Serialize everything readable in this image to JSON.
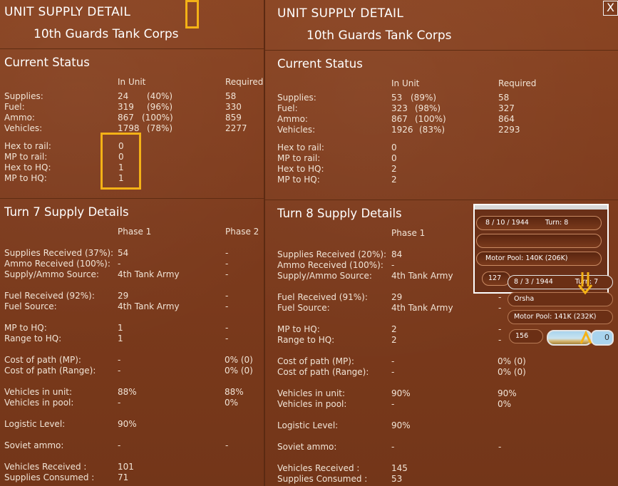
{
  "colors": {
    "panel": "#7d3b1d",
    "highlight": "#f4b216",
    "text": "#f3e6d8"
  },
  "left": {
    "title": "UNIT SUPPLY DETAIL",
    "unit": "10th Guards Tank Corps",
    "current_status": "Current Status",
    "col_in_unit": "In Unit",
    "col_required": "Required",
    "rows": [
      {
        "label": "Supplies:",
        "in": "24",
        "pct": "(40%)",
        "req": "58"
      },
      {
        "label": "Fuel:",
        "in": "319",
        "pct": "(96%)",
        "req": "330"
      },
      {
        "label": "Ammo:",
        "in": "867",
        "pct": "(100%)",
        "req": "859"
      },
      {
        "label": "Vehicles:",
        "in": "1798",
        "pct": "(78%)",
        "req": "2277"
      }
    ],
    "dist": [
      {
        "label": "Hex to rail:",
        "val": "0"
      },
      {
        "label": "MP to rail:",
        "val": "0"
      },
      {
        "label": "Hex to HQ:",
        "val": "1"
      },
      {
        "label": "MP to HQ:",
        "val": "1"
      }
    ],
    "turn_title": "Turn 7 Supply Details",
    "phase1": "Phase 1",
    "phase2": "Phase 2",
    "details": [
      {
        "label": "Supplies Received (37%):",
        "p1": "54",
        "p2": "-"
      },
      {
        "label": "Ammo Received (100%):",
        "p1": "-",
        "p2": "-"
      },
      {
        "label": "Supply/Ammo Source:",
        "p1": "4th Tank Army",
        "p2": "-"
      },
      {
        "label": "Fuel Received (92%):",
        "p1": "29",
        "p2": "-"
      },
      {
        "label": "Fuel Source:",
        "p1": "4th Tank Army",
        "p2": "-"
      },
      {
        "label": "MP to HQ:",
        "p1": "1",
        "p2": "-"
      },
      {
        "label": "Range to HQ:",
        "p1": "1",
        "p2": "-"
      },
      {
        "label": "Cost of path (MP):",
        "p1": "-",
        "p2": "0% (0)"
      },
      {
        "label": "Cost of path (Range):",
        "p1": "-",
        "p2": "0% (0)"
      },
      {
        "label": "Vehicles in unit:",
        "p1": "88%",
        "p2": "88%"
      },
      {
        "label": "Vehicles in pool:",
        "p1": "-",
        "p2": "0%"
      },
      {
        "label": "Logistic Level:",
        "p1": "90%",
        "p2": ""
      },
      {
        "label": "Soviet ammo:",
        "p1": "-",
        "p2": "-"
      },
      {
        "label": "Vehicles Received :",
        "p1": "101",
        "p2": ""
      },
      {
        "label": "Supplies Consumed :",
        "p1": "71",
        "p2": ""
      }
    ]
  },
  "right": {
    "title": "UNIT SUPPLY DETAIL",
    "unit": "10th Guards Tank Corps",
    "close": "X",
    "current_status": "Current Status",
    "col_in_unit": "In Unit",
    "col_required": "Required",
    "rows": [
      {
        "label": "Supplies:",
        "in": "53",
        "pct": "(89%)",
        "req": "58"
      },
      {
        "label": "Fuel:",
        "in": "323",
        "pct": "(98%)",
        "req": "327"
      },
      {
        "label": "Ammo:",
        "in": "867",
        "pct": "(100%)",
        "req": "864"
      },
      {
        "label": "Vehicles:",
        "in": "1926",
        "pct": "(83%)",
        "req": "2293"
      }
    ],
    "dist": [
      {
        "label": "Hex to rail:",
        "val": "0"
      },
      {
        "label": "MP to rail:",
        "val": "0"
      },
      {
        "label": "Hex to HQ:",
        "val": "2"
      },
      {
        "label": "MP to HQ:",
        "val": "2"
      }
    ],
    "turn_title": "Turn 8 Supply Details",
    "phase1": "Phase 1",
    "details": [
      {
        "label": "Supplies Received (20%):",
        "p1": "84",
        "p2": ""
      },
      {
        "label": "Ammo Received (100%):",
        "p1": "-",
        "p2": ""
      },
      {
        "label": "Supply/Ammo Source:",
        "p1": "4th Tank Army",
        "p2": ""
      },
      {
        "label": "Fuel Received (91%):",
        "p1": "29",
        "p2": "-"
      },
      {
        "label": "Fuel Source:",
        "p1": "4th Tank Army",
        "p2": "-"
      },
      {
        "label": "MP to HQ:",
        "p1": "2",
        "p2": "-"
      },
      {
        "label": "Range to HQ:",
        "p1": "2",
        "p2": "-"
      },
      {
        "label": "Cost of path (MP):",
        "p1": "-",
        "p2": "0% (0)"
      },
      {
        "label": "Cost of path (Range):",
        "p1": "-",
        "p2": "0% (0)"
      },
      {
        "label": "Vehicles in unit:",
        "p1": "90%",
        "p2": "90%"
      },
      {
        "label": "Vehicles in pool:",
        "p1": "-",
        "p2": "0%"
      },
      {
        "label": "Logistic Level:",
        "p1": "90%",
        "p2": ""
      },
      {
        "label": "Soviet ammo:",
        "p1": "-",
        "p2": "-"
      },
      {
        "label": "Vehicles Received :",
        "p1": "145",
        "p2": ""
      },
      {
        "label": "Supplies Consumed :",
        "p1": "53",
        "p2": ""
      }
    ]
  },
  "overlay": {
    "date1": "8 / 10 / 1944",
    "turn1": "Turn: 8",
    "motor1": "Motor Pool: 140K (206K)",
    "n1": "127",
    "date2": "8 / 3 / 1944",
    "turn2": "Turn: 7",
    "place": "Orsha",
    "motor2": "Motor Pool: 141K (232K)",
    "n2": "156",
    "btn": "0"
  }
}
